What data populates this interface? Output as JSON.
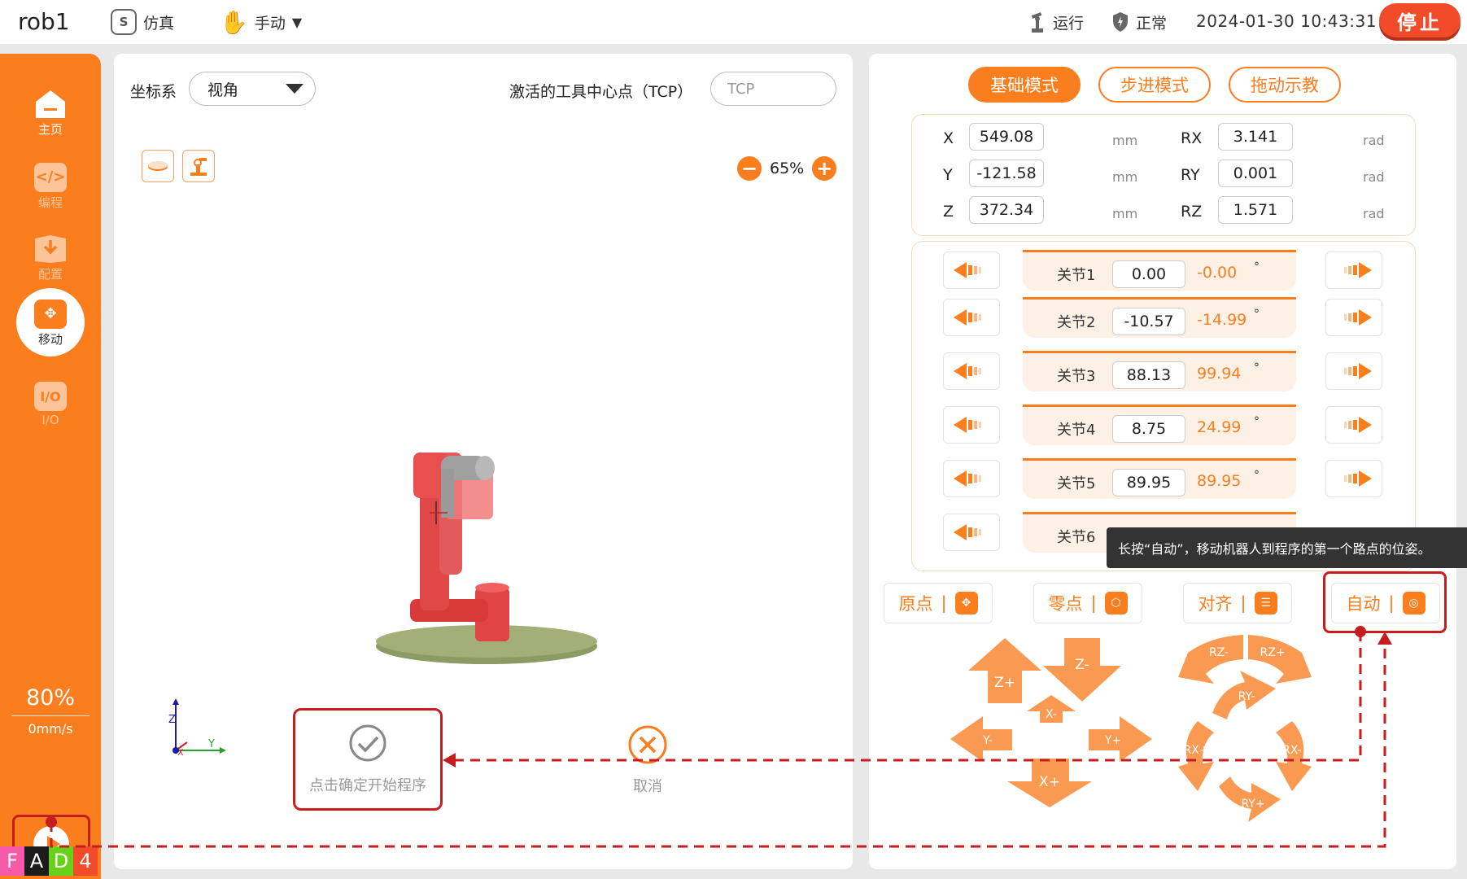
{
  "topbar": {
    "robot_name": "rob1",
    "sim_icon_letter": "S",
    "sim_label": "仿真",
    "manual_label": "手动",
    "run_label": "运行",
    "status_label": "正常",
    "datetime": "2024-01-30 10:43:31",
    "stop_label": "停止"
  },
  "sidebar": {
    "items": [
      {
        "label": "主页",
        "icon": "home-icon"
      },
      {
        "label": "编程",
        "icon": "code-icon"
      },
      {
        "label": "配置",
        "icon": "download-icon"
      },
      {
        "label": "移动",
        "icon": "move-icon"
      },
      {
        "label": "I/O",
        "icon": "io-icon"
      }
    ],
    "speed_percent": "80%",
    "speed_mm": "0mm/s",
    "fad": [
      {
        "char": "F",
        "color": "#f75aa8"
      },
      {
        "char": "A",
        "color": "#1c1c1c"
      },
      {
        "char": "D",
        "color": "#6ad11a"
      },
      {
        "char": "4",
        "color": "#f14b2a"
      }
    ]
  },
  "left_panel": {
    "coord_label": "坐标系",
    "coord_value": "视角",
    "tcp_label": "激活的工具中心点（TCP）",
    "tcp_placeholder": "TCP",
    "zoom": "65%",
    "confirm_label": "点击确定开始程序",
    "cancel_label": "取消"
  },
  "right_panel": {
    "modes": [
      "基础模式",
      "步进模式",
      "拖动示教"
    ],
    "coords": [
      {
        "axis": "X",
        "value": "549.08",
        "unit": "mm",
        "raxis": "RX",
        "rvalue": "3.141",
        "runit": "rad"
      },
      {
        "axis": "Y",
        "value": "-121.58",
        "unit": "mm",
        "raxis": "RY",
        "rvalue": "0.001",
        "runit": "rad"
      },
      {
        "axis": "Z",
        "value": "372.34",
        "unit": "mm",
        "raxis": "RZ",
        "rvalue": "1.571",
        "runit": "rad"
      }
    ],
    "joints": [
      {
        "label": "关节1",
        "value": "0.00",
        "target": "-0.00",
        "unit": "°"
      },
      {
        "label": "关节2",
        "value": "-10.57",
        "target": "-14.99",
        "unit": "°"
      },
      {
        "label": "关节3",
        "value": "88.13",
        "target": "99.94",
        "unit": "°"
      },
      {
        "label": "关节4",
        "value": "8.75",
        "target": "24.99",
        "unit": "°"
      },
      {
        "label": "关节5",
        "value": "89.95",
        "target": "89.95",
        "unit": "°"
      },
      {
        "label": "关节6",
        "value": "",
        "target": "",
        "unit": ""
      }
    ],
    "tooltip": "长按“自动”，移动机器人到程序的第一个路点的位姿。",
    "actions": [
      "原点",
      "零点",
      "对齐",
      "自动"
    ],
    "action_separator": "|",
    "jog": {
      "zp": "Z+",
      "zm": "Z-",
      "xm": "X-",
      "xp": "X+",
      "ym": "Y-",
      "yp": "Y+",
      "rzm": "RZ-",
      "rzp": "RZ+",
      "rym": "RY-",
      "ryp": "RY+",
      "rxp": "RX+",
      "rxm": "RX-"
    }
  },
  "colors": {
    "accent": "#fa7d1e",
    "stop": "#f14b2a",
    "highlight": "#c41e1e"
  }
}
